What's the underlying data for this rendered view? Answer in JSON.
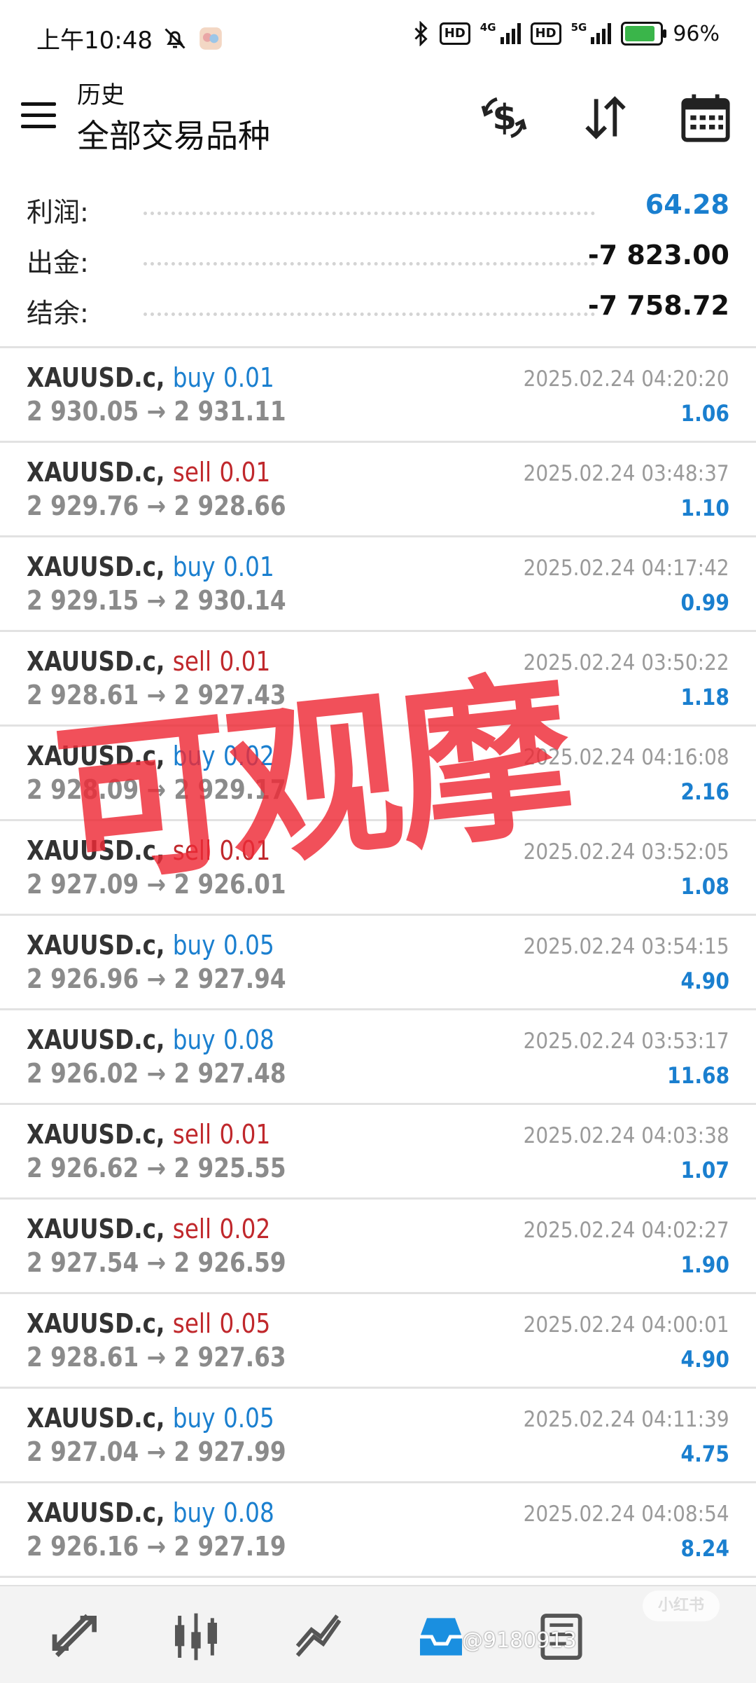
{
  "status_bar": {
    "time": "上午10:48",
    "network_1": "4G",
    "network_2": "5G",
    "hd_label": "HD",
    "battery": "96%"
  },
  "app_bar": {
    "subtitle": "历史",
    "title": "全部交易品种"
  },
  "summary": [
    {
      "label": "利润:",
      "value": "64.28",
      "color": "#1a7fcf"
    },
    {
      "label": "出金:",
      "value": "-7 823.00",
      "color": "#111111"
    },
    {
      "label": "结余:",
      "value": "-7 758.72",
      "color": "#111111"
    }
  ],
  "trades": [
    {
      "symbol": "XAUUSD.c,",
      "side": "buy",
      "volume": "0.01",
      "open": "2 930.05",
      "close": "2 931.11",
      "time": "2025.02.24 04:20:20",
      "profit": "1.06"
    },
    {
      "symbol": "XAUUSD.c,",
      "side": "sell",
      "volume": "0.01",
      "open": "2 929.76",
      "close": "2 928.66",
      "time": "2025.02.24 03:48:37",
      "profit": "1.10"
    },
    {
      "symbol": "XAUUSD.c,",
      "side": "buy",
      "volume": "0.01",
      "open": "2 929.15",
      "close": "2 930.14",
      "time": "2025.02.24 04:17:42",
      "profit": "0.99"
    },
    {
      "symbol": "XAUUSD.c,",
      "side": "sell",
      "volume": "0.01",
      "open": "2 928.61",
      "close": "2 927.43",
      "time": "2025.02.24 03:50:22",
      "profit": "1.18"
    },
    {
      "symbol": "XAUUSD.c,",
      "side": "buy",
      "volume": "0.02",
      "open": "2 928.09",
      "close": "2 929.17",
      "time": "2025.02.24 04:16:08",
      "profit": "2.16"
    },
    {
      "symbol": "XAUUSD.c,",
      "side": "sell",
      "volume": "0.01",
      "open": "2 927.09",
      "close": "2 926.01",
      "time": "2025.02.24 03:52:05",
      "profit": "1.08"
    },
    {
      "symbol": "XAUUSD.c,",
      "side": "buy",
      "volume": "0.05",
      "open": "2 926.96",
      "close": "2 927.94",
      "time": "2025.02.24 03:54:15",
      "profit": "4.90"
    },
    {
      "symbol": "XAUUSD.c,",
      "side": "buy",
      "volume": "0.08",
      "open": "2 926.02",
      "close": "2 927.48",
      "time": "2025.02.24 03:53:17",
      "profit": "11.68"
    },
    {
      "symbol": "XAUUSD.c,",
      "side": "sell",
      "volume": "0.01",
      "open": "2 926.62",
      "close": "2 925.55",
      "time": "2025.02.24 04:03:38",
      "profit": "1.07"
    },
    {
      "symbol": "XAUUSD.c,",
      "side": "sell",
      "volume": "0.02",
      "open": "2 927.54",
      "close": "2 926.59",
      "time": "2025.02.24 04:02:27",
      "profit": "1.90"
    },
    {
      "symbol": "XAUUSD.c,",
      "side": "sell",
      "volume": "0.05",
      "open": "2 928.61",
      "close": "2 927.63",
      "time": "2025.02.24 04:00:01",
      "profit": "4.90"
    },
    {
      "symbol": "XAUUSD.c,",
      "side": "buy",
      "volume": "0.05",
      "open": "2 927.04",
      "close": "2 927.99",
      "time": "2025.02.24 04:11:39",
      "profit": "4.75"
    },
    {
      "symbol": "XAUUSD.c,",
      "side": "buy",
      "volume": "0.08",
      "open": "2 926.16",
      "close": "2 927.19",
      "time": "2025.02.24 04:08:54",
      "profit": "8.24"
    }
  ],
  "watermark": "可观摩",
  "overlay": {
    "xhs_logo": "小红书",
    "xhs_id": "@9180913"
  },
  "nav_icons": [
    "trade-arrows-icon",
    "candlestick-chart-icon",
    "trend-chart-icon",
    "history-inbox-icon",
    "news-icon"
  ],
  "colors": {
    "buy": "#1a7fcf",
    "sell": "#c0282c",
    "profit": "#1a7fcf",
    "watermark": "#ee2a36",
    "active_nav": "#1a8fe0"
  }
}
